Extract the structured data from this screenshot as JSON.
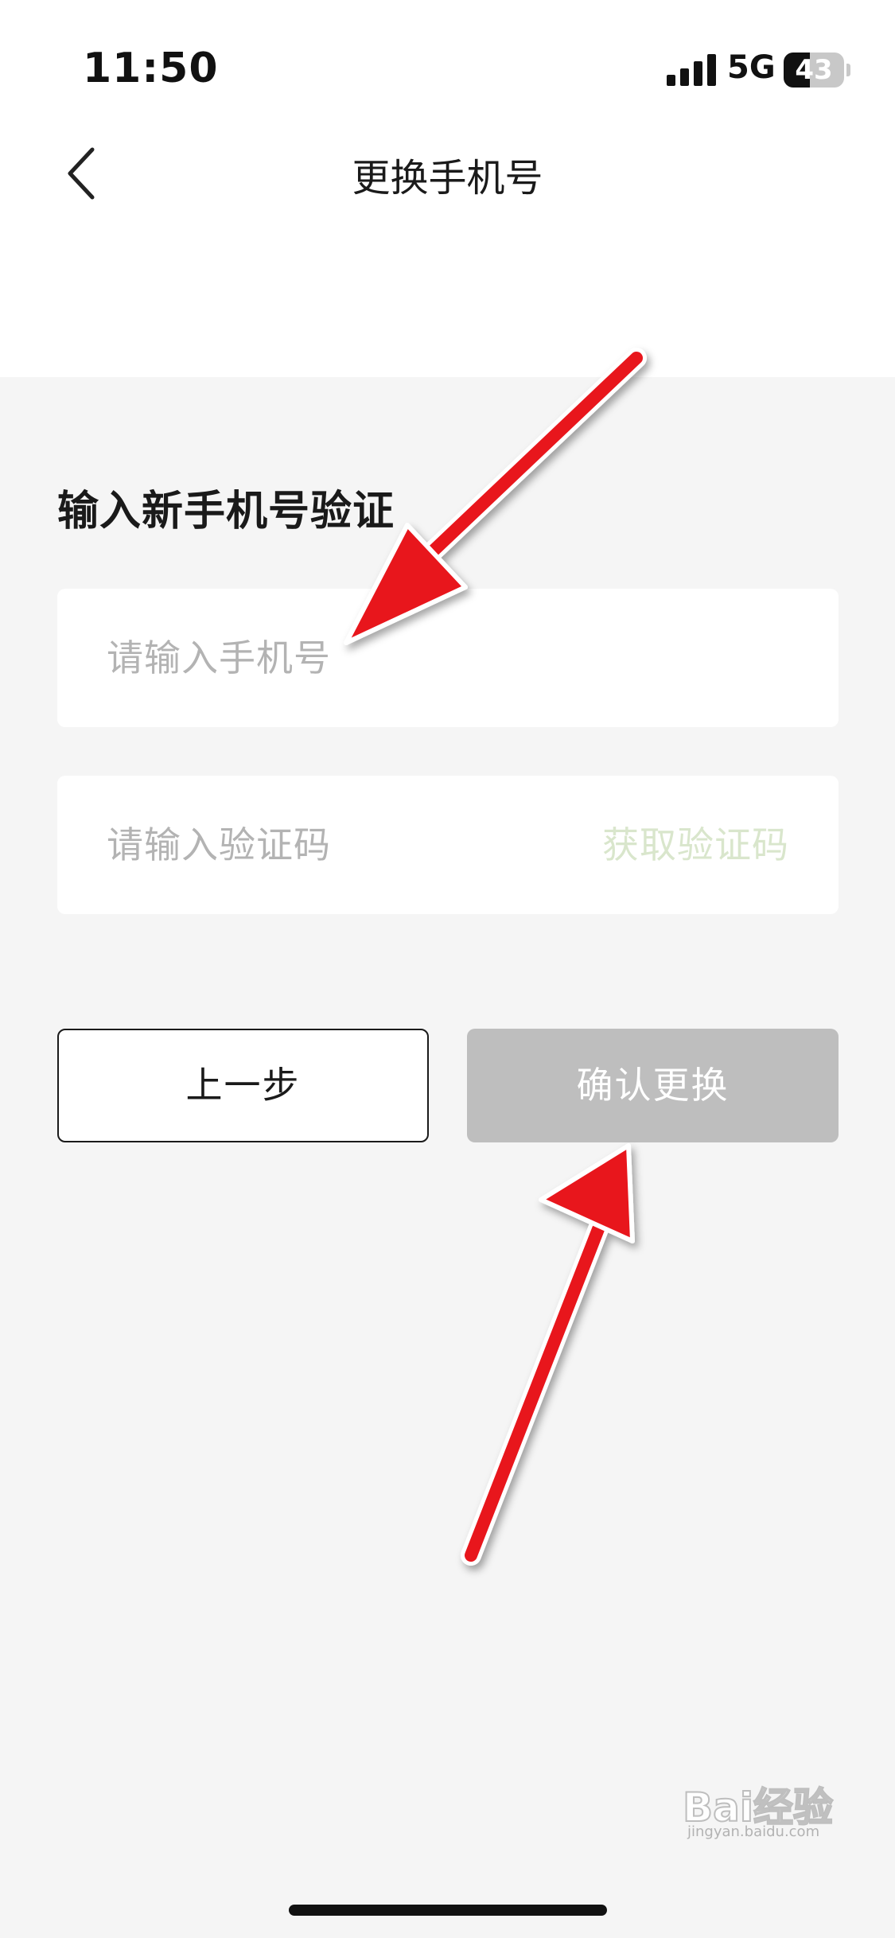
{
  "status_bar": {
    "time": "11:50",
    "network": "5G",
    "battery": "43",
    "battery_level": 0.43
  },
  "nav": {
    "title": "更换手机号",
    "back_icon": "chevron-left-icon"
  },
  "form": {
    "section_title": "输入新手机号验证",
    "phone_placeholder": "请输入手机号",
    "code_placeholder": "请输入验证码",
    "get_code_label": "获取验证码"
  },
  "buttons": {
    "prev_label": "上一步",
    "confirm_label": "确认更换"
  },
  "watermark": {
    "text": "Bai经验",
    "sub": "jingyan.baidu.com"
  },
  "colors": {
    "background": "#f5f5f5",
    "header": "#ffffff",
    "placeholder": "#b3b3b3",
    "get_code": "#d9e6cc",
    "confirm_disabled": "#bebebe",
    "annotation_arrow": "#e8121c"
  }
}
